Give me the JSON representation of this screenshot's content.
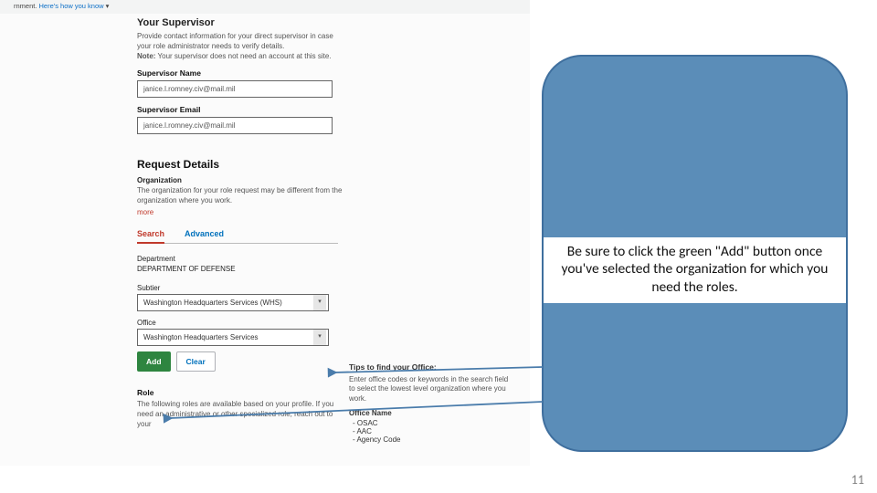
{
  "topbar": {
    "text_prefix": "rnment. ",
    "link": "Here's how you know",
    "caret": "▾"
  },
  "supervisor": {
    "title": "Your Supervisor",
    "help1": "Provide contact information for your direct supervisor in case your role administrator needs to verify details.",
    "help2_bold": "Note:",
    "help2_rest": " Your supervisor does not need an account at this site.",
    "name_label": "Supervisor Name",
    "name_value": "janice.l.romney.civ@mail.mil",
    "email_label": "Supervisor Email",
    "email_value": "janice.l.romney.civ@mail.mil"
  },
  "request": {
    "title": "Request Details",
    "org_label": "Organization",
    "org_help": "The organization for your role request may be different from the organization where you work.",
    "more": "more",
    "tabs": {
      "search": "Search",
      "advanced": "Advanced"
    },
    "dept_label": "Department",
    "dept_value": "DEPARTMENT OF DEFENSE",
    "subtier_label": "Subtier",
    "subtier_value": "Washington Headquarters Services (WHS)",
    "office_label": "Office",
    "office_value": "Washington Headquarters Services",
    "add_label": "Add",
    "clear_label": "Clear",
    "role_label": "Role",
    "role_help": "The following roles are available based on your profile. If you need an administrative or other specialized role, reach out to your"
  },
  "tips": {
    "title": "Tips to find your Office:",
    "body": "Enter office codes or keywords in the search field to select the lowest level organization where you work.",
    "office_name_label": "Office Name",
    "items": [
      "OSAC",
      "AAC",
      "Agency Code"
    ]
  },
  "callout": {
    "text": "Be sure to click the green \"Add\" button once you've selected the organization for which you need the roles."
  },
  "page_number": "11"
}
